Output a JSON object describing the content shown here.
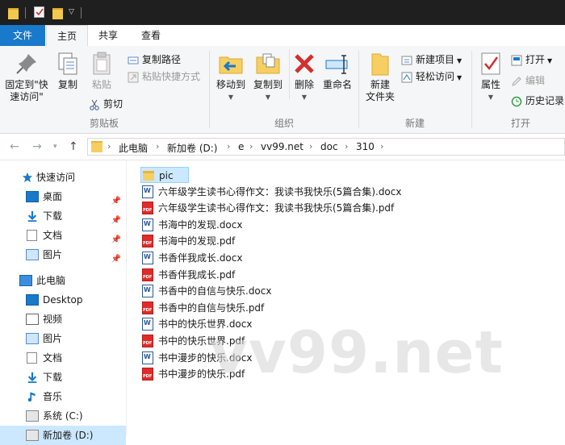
{
  "ribbon_tabs": [
    "文件",
    "主页",
    "共享",
    "查看"
  ],
  "clipboard": {
    "pin_label_1": "固定到\"快",
    "pin_label_2": "速访问\"",
    "copy": "复制",
    "paste": "粘贴",
    "copy_path": "复制路径",
    "paste_shortcut": "粘贴快捷方式",
    "cut": "剪切",
    "group": "剪贴板"
  },
  "organize": {
    "move_to": "移动到",
    "copy_to": "复制到",
    "delete": "删除",
    "rename": "重命名",
    "group": "组织"
  },
  "new_group": {
    "new_folder_1": "新建",
    "new_folder_2": "文件夹",
    "new_item": "新建项目",
    "easy_access": "轻松访问",
    "group": "新建"
  },
  "open_group": {
    "properties": "属性",
    "open": "打开",
    "edit": "编辑",
    "history": "历史记录",
    "group": "打开"
  },
  "address": {
    "crumbs": [
      "此电脑",
      "新加卷 (D:)",
      "e",
      "vv99.net",
      "doc",
      "310"
    ]
  },
  "nav": {
    "quick_access": "快速访问",
    "quick_items": [
      "桌面",
      "下载",
      "文档",
      "图片"
    ],
    "this_pc": "此电脑",
    "pc_items": [
      "Desktop",
      "视频",
      "图片",
      "文档",
      "下载",
      "音乐",
      "系统 (C:)",
      "新加卷 (D:)"
    ]
  },
  "files": [
    {
      "name": "pic",
      "type": "folder"
    },
    {
      "name": "六年级学生读书心得作文：我读书我快乐(5篇合集).docx",
      "type": "docx"
    },
    {
      "name": "六年级学生读书心得作文：我读书我快乐(5篇合集).pdf",
      "type": "pdf"
    },
    {
      "name": "书海中的发现.docx",
      "type": "docx"
    },
    {
      "name": "书海中的发现.pdf",
      "type": "pdf"
    },
    {
      "name": "书香伴我成长.docx",
      "type": "docx"
    },
    {
      "name": "书香伴我成长.pdf",
      "type": "pdf"
    },
    {
      "name": "书香中的自信与快乐.docx",
      "type": "docx"
    },
    {
      "name": "书香中的自信与快乐.pdf",
      "type": "pdf"
    },
    {
      "name": "书中的快乐世界.docx",
      "type": "docx"
    },
    {
      "name": "书中的快乐世界.pdf",
      "type": "pdf"
    },
    {
      "name": "书中漫步的快乐.docx",
      "type": "docx"
    },
    {
      "name": "书中漫步的快乐.pdf",
      "type": "pdf"
    }
  ],
  "watermark": "vv99.net",
  "colors": {
    "accent": "#1979ca",
    "selection": "#cce8ff",
    "folder": "#f6cf62"
  }
}
